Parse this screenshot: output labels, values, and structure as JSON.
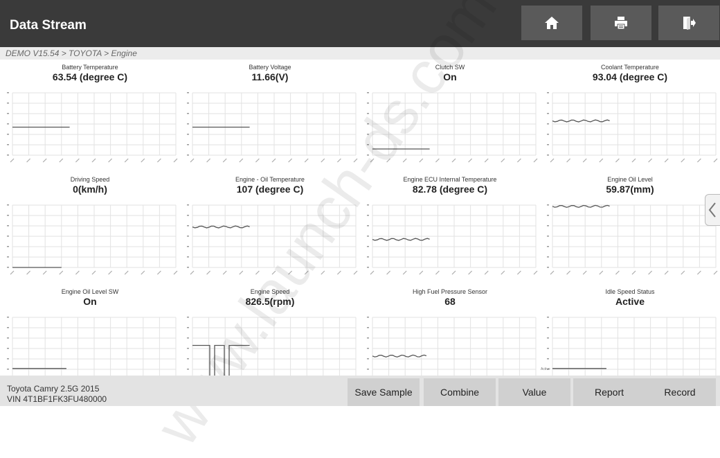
{
  "header": {
    "title": "Data Stream",
    "buttons": [
      {
        "name": "home-button",
        "icon": "home-icon"
      },
      {
        "name": "print-button",
        "icon": "printer-icon"
      },
      {
        "name": "exit-button",
        "icon": "exit-icon"
      }
    ]
  },
  "breadcrumb": "DEMO V15.54 > TOYOTA > Engine",
  "watermark": "www.launch-ds.com",
  "panels": [
    {
      "name": "Battery Temperature",
      "value": "63.54 (degree C)",
      "level": 0.55,
      "shape": "flat",
      "x_extent": 0.35
    },
    {
      "name": "Battery Voltage",
      "value": "11.66(V)",
      "level": 0.55,
      "shape": "flat",
      "x_extent": 0.35
    },
    {
      "name": "Clutch SW",
      "value": "On",
      "level": 0.9,
      "shape": "flat",
      "x_extent": 0.35
    },
    {
      "name": "Coolant Temperature",
      "value": "93.04 (degree C)",
      "level": 0.45,
      "shape": "wavy",
      "x_extent": 0.35
    },
    {
      "name": "Driving Speed",
      "value": "0(km/h)",
      "level": 1.0,
      "shape": "flat",
      "x_extent": 0.3
    },
    {
      "name": "Engine - Oil Temperature",
      "value": "107 (degree C)",
      "level": 0.35,
      "shape": "wavy",
      "x_extent": 0.35
    },
    {
      "name": "Engine ECU Internal Temperature",
      "value": "82.78 (degree C)",
      "level": 0.55,
      "shape": "wavy",
      "x_extent": 0.35
    },
    {
      "name": "Engine Oil Level",
      "value": "59.87(mm)",
      "level": 0.02,
      "shape": "wavy",
      "x_extent": 0.35
    },
    {
      "name": "Engine Oil Level SW",
      "value": "On",
      "level": 0.82,
      "shape": "flat",
      "x_extent": 0.33
    },
    {
      "name": "Engine Speed",
      "value": "826.5(rpm)",
      "level": 0.45,
      "shape": "square",
      "x_extent": 0.35
    },
    {
      "name": "High Fuel Pressure Sensor",
      "value": "68",
      "level": 0.62,
      "shape": "wavy",
      "x_extent": 0.33
    },
    {
      "name": "Idle Speed Status",
      "value": "Active",
      "level": 0.82,
      "shape": "flat",
      "x_extent": 0.33,
      "y_tick_label": "Active"
    }
  ],
  "footer": {
    "vehicle": "Toyota Camry 2.5G 2015",
    "vin": "VIN 4T1BF1FK3FU480000",
    "buttons": [
      "Save Sample",
      "Combine",
      "Value",
      "Report",
      "Record"
    ]
  },
  "colors": {
    "topbar": "#3a3a3a",
    "button": "#5a5a5a",
    "series": "#555555",
    "grid": "#e2e2e2"
  }
}
